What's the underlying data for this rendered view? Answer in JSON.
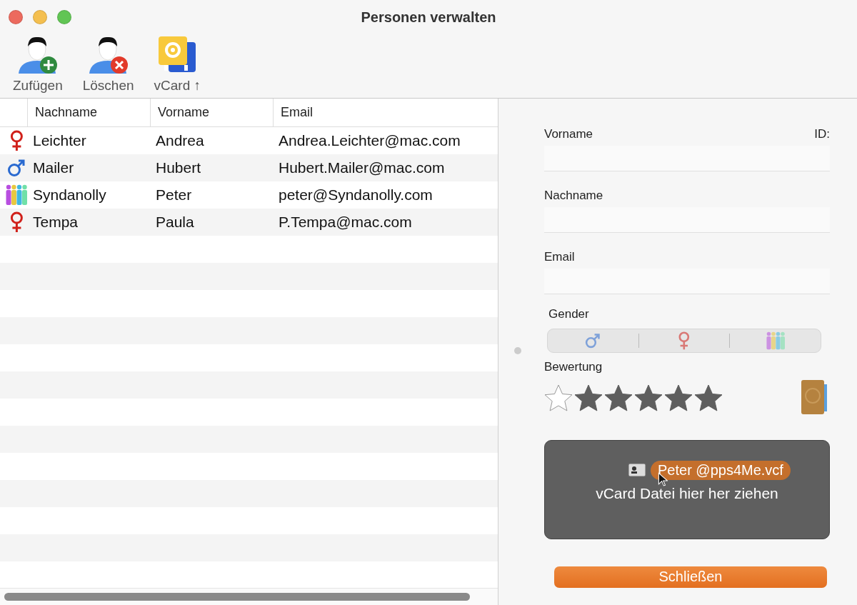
{
  "window": {
    "title": "Personen verwalten"
  },
  "toolbar": [
    {
      "kind": "add",
      "label": "Zufügen"
    },
    {
      "kind": "delete",
      "label": "Löschen"
    },
    {
      "kind": "vcard",
      "label": "vCard ↑"
    }
  ],
  "table": {
    "columns": [
      "Nachname",
      "Vorname",
      "Email"
    ],
    "rows": [
      {
        "kind": "female",
        "last": "Leichter",
        "first": "Andrea",
        "email": "Andrea.Leichter@mac.com"
      },
      {
        "kind": "male",
        "last": "Mailer",
        "first": "Hubert",
        "email": "Hubert.Mailer@mac.com"
      },
      {
        "kind": "group",
        "last": "Syndanolly",
        "first": "Peter",
        "email": "peter@Syndanolly.com"
      },
      {
        "kind": "female",
        "last": "Tempa",
        "first": "Paula",
        "email": "P.Tempa@mac.com"
      }
    ]
  },
  "form": {
    "id_label": "ID:",
    "fields": [
      {
        "label": "Vorname"
      },
      {
        "label": "Nachname"
      },
      {
        "label": "Email"
      }
    ],
    "gender_label": "Gender",
    "gender_options": [
      {
        "kind": "male",
        "selected": false
      },
      {
        "kind": "female",
        "selected": false
      },
      {
        "kind": "group",
        "selected": false
      }
    ],
    "rating_label": "Bewertung",
    "stars": 5,
    "drop_zone": {
      "text": "vCard Datei hier her ziehen",
      "dragged_file": "Peter @pps4Me.vcf"
    },
    "close_button": "Schließen"
  }
}
